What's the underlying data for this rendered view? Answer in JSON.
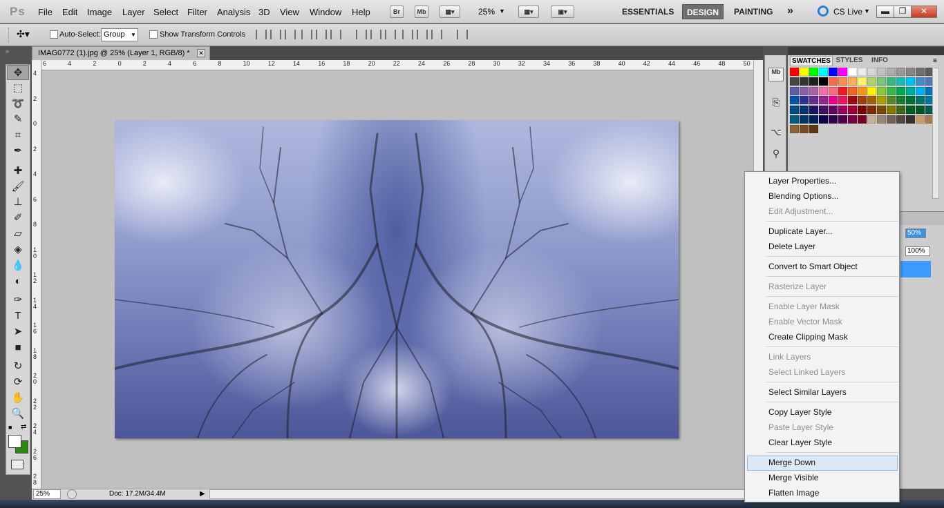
{
  "app": {
    "logo": "Ps"
  },
  "menu": [
    "File",
    "Edit",
    "Image",
    "Layer",
    "Select",
    "Filter",
    "Analysis",
    "3D",
    "View",
    "Window",
    "Help"
  ],
  "appbar": {
    "bridge": "Br",
    "minibridge": "Mb",
    "zoom": "25%",
    "zoom_arrow": "▼"
  },
  "workspaces": {
    "essentials": "ESSENTIALS",
    "design": "DESIGN",
    "painting": "PAINTING",
    "more": "»"
  },
  "cslive": "CS Live",
  "window_controls": {
    "minimize": "▬",
    "restore": "❐",
    "close": "✕"
  },
  "options": {
    "auto_select": "Auto-Select:",
    "auto_select_value": "Group",
    "show_transform": "Show Transform Controls"
  },
  "document": {
    "tab_title": "IMAG0772 (1).jpg @ 25% (Layer 1, RGB/8) *",
    "close": "✕"
  },
  "ruler": {
    "h": [
      "6",
      "4",
      "2",
      "0",
      "2",
      "4",
      "6",
      "8",
      "10",
      "12",
      "14",
      "16",
      "18",
      "20",
      "22",
      "24",
      "26",
      "28",
      "30",
      "32",
      "34",
      "36",
      "38",
      "40",
      "42",
      "44",
      "46",
      "48",
      "50"
    ],
    "v": [
      "4",
      "2",
      "0",
      "2",
      "4",
      "6",
      "8",
      "1\n0",
      "1\n2",
      "1\n4",
      "1\n6",
      "1\n8",
      "2\n0",
      "2\n2",
      "2\n4",
      "2\n6",
      "2\n8"
    ]
  },
  "status": {
    "zoom": "25%",
    "doc": "Doc: 17.2M/34.4M"
  },
  "panels": {
    "tabs": [
      "SWATCHES",
      "STYLES",
      "INFO"
    ],
    "opacity": "50%",
    "fill": "100%"
  },
  "swatch_colors": [
    "#ff0000",
    "#ffff00",
    "#00ff00",
    "#00ffff",
    "#0000ff",
    "#ff00ff",
    "#ffffff",
    "#ebebeb",
    "#d6d6d6",
    "#c2c2c2",
    "#adadad",
    "#999999",
    "#858585",
    "#707070",
    "#5c5c5c",
    "#474747",
    "#333333",
    "#1f1f1f",
    "#000000",
    "#f26c4f",
    "#f68e55",
    "#fbaf5c",
    "#fff467",
    "#acd372",
    "#7cc576",
    "#3bb878",
    "#1abbb4",
    "#00bff3",
    "#438ccb",
    "#5574b9",
    "#605ca8",
    "#855fa8",
    "#a763a8",
    "#f06ea9",
    "#f26d7d",
    "#ed1c24",
    "#f26522",
    "#f7941d",
    "#fff200",
    "#8dc73f",
    "#39b54a",
    "#00a651",
    "#00a99d",
    "#00aeef",
    "#0072bc",
    "#0054a6",
    "#2e3192",
    "#662d91",
    "#92278f",
    "#ec008c",
    "#ed145b",
    "#9e0b0f",
    "#a0410d",
    "#a36209",
    "#aba000",
    "#598527",
    "#1a7b30",
    "#007236",
    "#00746b",
    "#0076a3",
    "#004b80",
    "#003471",
    "#1b1464",
    "#440e62",
    "#630460",
    "#9e005d",
    "#9e0039",
    "#790000",
    "#7b2e00",
    "#7d4900",
    "#827b00",
    "#406618",
    "#005e20",
    "#005826",
    "#005952",
    "#005b7f",
    "#003663",
    "#002157",
    "#0d004c",
    "#32004b",
    "#4b0049",
    "#7b0046",
    "#7a0026",
    "#c7b299",
    "#998675",
    "#736357",
    "#534741",
    "#37302d",
    "#c69c6d",
    "#a67c52",
    "#8c6239",
    "#754c24",
    "#603913"
  ],
  "context_menu": {
    "items": [
      {
        "label": "Layer Properties...",
        "disabled": false
      },
      {
        "label": "Blending Options...",
        "disabled": false
      },
      {
        "label": "Edit Adjustment...",
        "disabled": true
      },
      {
        "label": "Duplicate Layer...",
        "disabled": false
      },
      {
        "label": "Delete Layer",
        "disabled": false
      },
      {
        "label": "Convert to Smart Object",
        "disabled": false
      },
      {
        "label": "Rasterize Layer",
        "disabled": true
      },
      {
        "label": "Enable Layer Mask",
        "disabled": true
      },
      {
        "label": "Enable Vector Mask",
        "disabled": true
      },
      {
        "label": "Create Clipping Mask",
        "disabled": false
      },
      {
        "label": "Link Layers",
        "disabled": true
      },
      {
        "label": "Select Linked Layers",
        "disabled": true
      },
      {
        "label": "Select Similar Layers",
        "disabled": false
      },
      {
        "label": "Copy Layer Style",
        "disabled": false
      },
      {
        "label": "Paste Layer Style",
        "disabled": true
      },
      {
        "label": "Clear Layer Style",
        "disabled": false
      },
      {
        "label": "Merge Down",
        "disabled": false,
        "highlighted": true
      },
      {
        "label": "Merge Visible",
        "disabled": false
      },
      {
        "label": "Flatten Image",
        "disabled": false
      }
    ]
  }
}
